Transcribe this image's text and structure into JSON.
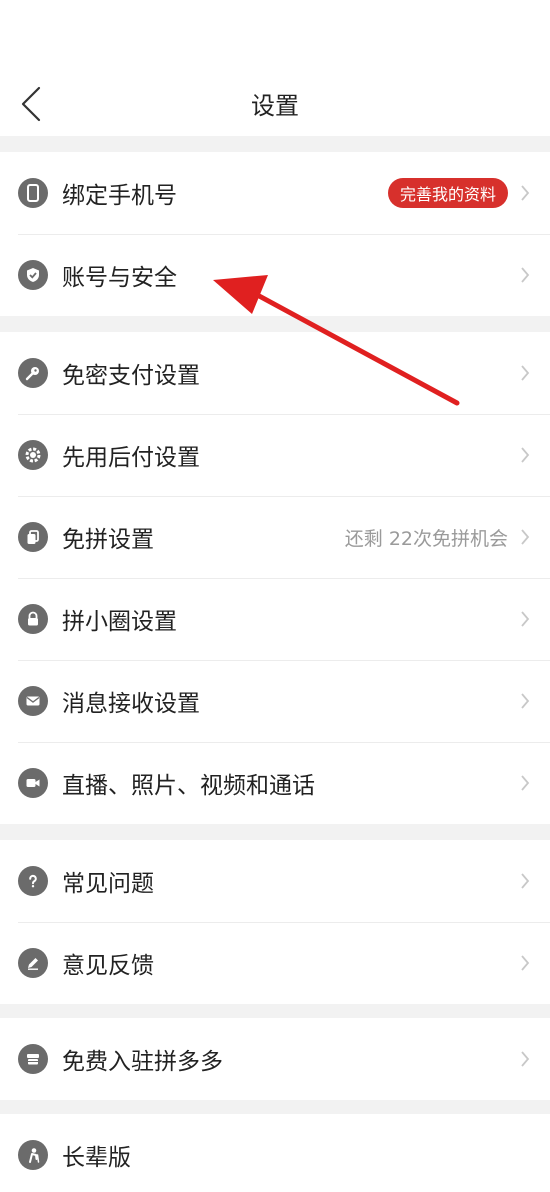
{
  "header": {
    "title": "设置"
  },
  "groups": [
    {
      "items": [
        {
          "label": "绑定手机号",
          "icon": "phone-icon",
          "badge": "完善我的资料"
        },
        {
          "label": "账号与安全",
          "icon": "shield-check-icon"
        }
      ]
    },
    {
      "items": [
        {
          "label": "免密支付设置",
          "icon": "key-icon"
        },
        {
          "label": "先用后付设置",
          "icon": "gear-icon"
        },
        {
          "label": "免拼设置",
          "icon": "copy-icon",
          "right_text": "还剩 22次免拼机会"
        },
        {
          "label": "拼小圈设置",
          "icon": "lock-icon"
        },
        {
          "label": "消息接收设置",
          "icon": "mail-icon"
        },
        {
          "label": "直播、照片、视频和通话",
          "icon": "video-camera-icon"
        }
      ]
    },
    {
      "items": [
        {
          "label": "常见问题",
          "icon": "question-icon"
        },
        {
          "label": "意见反馈",
          "icon": "pencil-icon"
        }
      ]
    },
    {
      "items": [
        {
          "label": "免费入驻拼多多",
          "icon": "store-icon"
        }
      ]
    },
    {
      "items": [
        {
          "label": "长辈版",
          "icon": "elder-icon"
        }
      ]
    }
  ],
  "colors": {
    "badge": "#d7302c",
    "annotation_arrow": "#e02020",
    "icon": "#6b6b6b",
    "separator": "#f2f2f2"
  }
}
